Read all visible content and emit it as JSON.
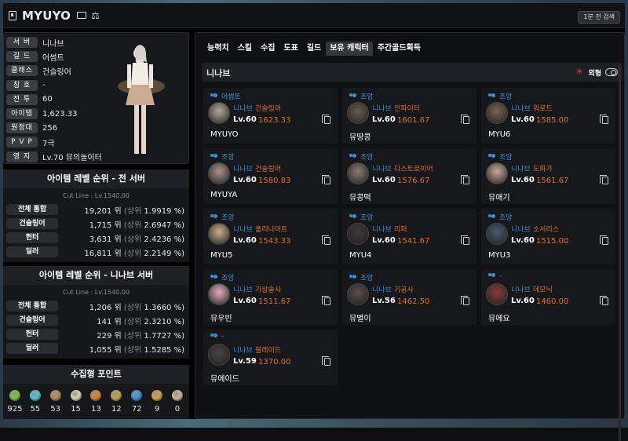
{
  "header": {
    "title": "MYUYO",
    "search_btn": "1분 전 검색"
  },
  "profile": {
    "rows": [
      {
        "label": "서 버",
        "value": "니나브"
      },
      {
        "label": "길 드",
        "value": "어썸트"
      },
      {
        "label": "클래스",
        "value": "건슬링어"
      },
      {
        "label": "칭 호",
        "value": "-"
      },
      {
        "label": "전 투",
        "value": "60"
      },
      {
        "label": "아이템",
        "value": "1,623.33"
      },
      {
        "label": "원정대",
        "value": "256"
      },
      {
        "label": "P V P",
        "value": "7극"
      },
      {
        "label": "영 지",
        "value": "Lv.70 뮤의놀이터"
      }
    ]
  },
  "rank_all": {
    "title": "아이템 레벨 순위 - 전 서버",
    "cutline": "Cut Line : Lv.1540.00",
    "rows": [
      {
        "label": "전체 통합",
        "rank": "19,201 위",
        "top": "(상위",
        "pct": "1.9919 %)"
      },
      {
        "label": "건슬링어",
        "rank": "1,715 위",
        "top": "(상위",
        "pct": "2.6947 %)"
      },
      {
        "label": "헌터",
        "rank": "3,631 위",
        "top": "(상위",
        "pct": "2.4236 %)"
      },
      {
        "label": "딜러",
        "rank": "16,811 위",
        "top": "(상위",
        "pct": "2.2149 %)"
      }
    ]
  },
  "rank_server": {
    "title": "아이템 레벨 순위 - 니나브 서버",
    "cutline": "Cut Line : Lv.1540.00",
    "rows": [
      {
        "label": "전체 통합",
        "rank": "1,206 위",
        "top": "(상위",
        "pct": "1.3660 %)"
      },
      {
        "label": "건슬링어",
        "rank": "141 위",
        "top": "(상위",
        "pct": "2.3210 %)"
      },
      {
        "label": "헌터",
        "rank": "229 위",
        "top": "(상위",
        "pct": "1.7727 %)"
      },
      {
        "label": "딜러",
        "rank": "1,055 위",
        "top": "(상위",
        "pct": "1.5285 %)"
      }
    ]
  },
  "collect": {
    "title": "수집형 포인트",
    "items": [
      {
        "icon": "mokoko-seed-icon",
        "color": "#7fbf3a",
        "value": "925"
      },
      {
        "icon": "island-heart-icon",
        "color": "#4fc6d9",
        "value": "55"
      },
      {
        "icon": "great-art-icon",
        "color": "#b08a5a",
        "value": "53"
      },
      {
        "icon": "giant-heart-icon",
        "color": "#d9d2b0",
        "value": "15"
      },
      {
        "icon": "ignea-token-icon",
        "color": "#d97f2a",
        "value": "13"
      },
      {
        "icon": "voyage-icon",
        "color": "#c7a04a",
        "value": "12"
      },
      {
        "icon": "world-tree-leaf-icon",
        "color": "#3b8fd9",
        "value": "72"
      },
      {
        "icon": "orpheus-star-icon",
        "color": "#d9a040",
        "value": "9"
      },
      {
        "icon": "omnium-star-icon",
        "color": "#c9b68a",
        "value": "0"
      }
    ]
  },
  "tabs": [
    "능력치",
    "스킬",
    "수집",
    "도표",
    "길드",
    "보유 캐릭터",
    "주간골드획득"
  ],
  "active_tab": 5,
  "server_header": {
    "name": "니나브",
    "look_label": "외형"
  },
  "characters": [
    {
      "guild": "어썸트",
      "server": "니나브",
      "class": "건슬링어",
      "lv": "Lv.60",
      "ilvl": "1623.33",
      "name": "MYUYO",
      "avatar": "#b9a89c"
    },
    {
      "guild": "조앙",
      "server": "니나브",
      "class": "인파이터",
      "lv": "Lv.60",
      "ilvl": "1601.67",
      "name": "뮤땅콩",
      "avatar": "#6a5a4e"
    },
    {
      "guild": "조앙",
      "server": "니나브",
      "class": "워로드",
      "lv": "Lv.60",
      "ilvl": "1585.00",
      "name": "MYU6",
      "avatar": "#7a6450"
    },
    {
      "guild": "조앙",
      "server": "니나브",
      "class": "건슬링어",
      "lv": "Lv.60",
      "ilvl": "1580.83",
      "name": "MYUYA",
      "avatar": "#a89488"
    },
    {
      "guild": "조앙",
      "server": "니나브",
      "class": "디스트로이어",
      "lv": "Lv.60",
      "ilvl": "1576.67",
      "name": "뮤콩떡",
      "avatar": "#8a7c6c"
    },
    {
      "guild": "조앙",
      "server": "니나브",
      "class": "도화가",
      "lv": "Lv.60",
      "ilvl": "1561.67",
      "name": "뮤애기",
      "avatar": "#c9a89a"
    },
    {
      "guild": "조앙",
      "server": "니나브",
      "class": "홀리나이트",
      "lv": "Lv.60",
      "ilvl": "1543.33",
      "name": "MYU5",
      "avatar": "#c9b08a"
    },
    {
      "guild": "조앙",
      "server": "니나브",
      "class": "리퍼",
      "lv": "Lv.60",
      "ilvl": "1541.67",
      "name": "MYU4",
      "avatar": "#3e3a38"
    },
    {
      "guild": "조앙",
      "server": "니나브",
      "class": "소서리스",
      "lv": "Lv.60",
      "ilvl": "1515.00",
      "name": "MYU3",
      "avatar": "#4a5a6e"
    },
    {
      "guild": "조앙",
      "server": "니나브",
      "class": "기상술사",
      "lv": "Lv.60",
      "ilvl": "1511.67",
      "name": "뮤우빈",
      "avatar": "#e0b0b8"
    },
    {
      "guild": "조앙",
      "server": "니나브",
      "class": "기공사",
      "lv": "Lv.56",
      "ilvl": "1462.50",
      "name": "뮤별이",
      "avatar": "#5a4e48"
    },
    {
      "guild": "-",
      "server": "니나브",
      "class": "데모닉",
      "lv": "Lv.60",
      "ilvl": "1460.00",
      "name": "뮤에요",
      "avatar": "#8a3a3a"
    },
    {
      "guild": "-",
      "server": "니나브",
      "class": "블레이드",
      "lv": "Lv.59",
      "ilvl": "1370.00",
      "name": "뮤에이드",
      "avatar": "#4a4440"
    }
  ]
}
